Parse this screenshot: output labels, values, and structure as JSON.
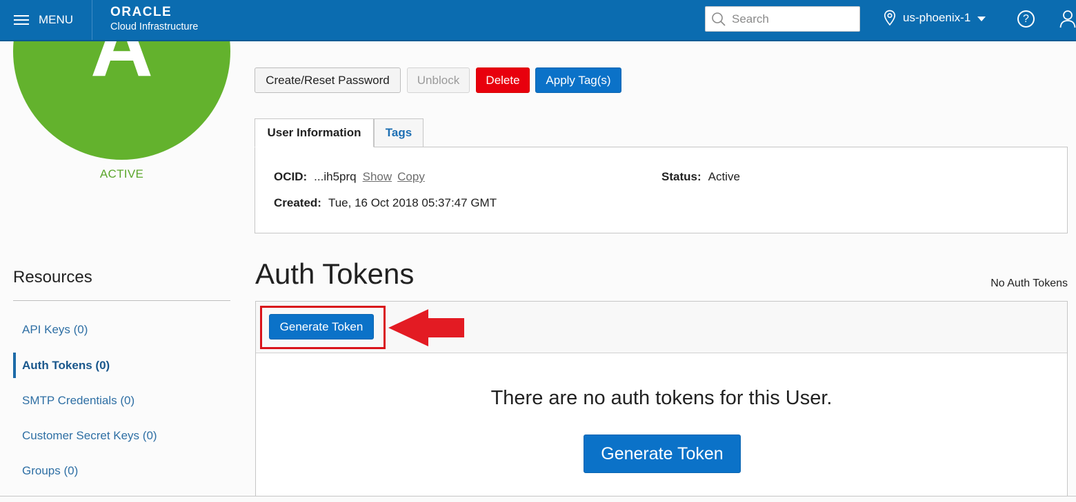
{
  "header": {
    "menu_label": "MENU",
    "brand_name": "ORACLE",
    "brand_sub": "Cloud Infrastructure",
    "search_placeholder": "Search",
    "region": "us-phoenix-1",
    "help_glyph": "?"
  },
  "user": {
    "avatar_letter": "A",
    "status_text": "ACTIVE",
    "colors": {
      "avatar": "#63b22d",
      "status": "#5aa62a"
    }
  },
  "actions": {
    "create_reset": "Create/Reset Password",
    "unblock": "Unblock",
    "delete": "Delete",
    "apply_tags": "Apply Tag(s)"
  },
  "tabs": {
    "user_info": "User Information",
    "tags": "Tags"
  },
  "info": {
    "ocid_label": "OCID:",
    "ocid_value": "...ih5prq",
    "show_link": "Show",
    "copy_link": "Copy",
    "created_label": "Created:",
    "created_value": "Tue, 16 Oct 2018 05:37:47 GMT",
    "status_label": "Status:",
    "status_value": "Active"
  },
  "resources": {
    "title": "Resources",
    "items": [
      {
        "label": "API Keys (0)",
        "active": false
      },
      {
        "label": "Auth Tokens (0)",
        "active": true
      },
      {
        "label": "SMTP Credentials (0)",
        "active": false
      },
      {
        "label": "Customer Secret Keys (0)",
        "active": false
      },
      {
        "label": "Groups (0)",
        "active": false
      }
    ]
  },
  "auth_tokens": {
    "title": "Auth Tokens",
    "count_label": "No Auth Tokens",
    "toolbar_button": "Generate Token",
    "empty_message": "There are no auth tokens for this User.",
    "empty_button": "Generate Token",
    "annotation_color": "#e31b23"
  }
}
